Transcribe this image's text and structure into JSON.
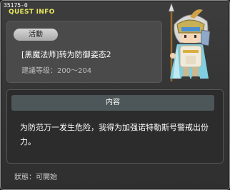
{
  "window": {
    "quest_id": "35175-0",
    "title": "QUEST INFO"
  },
  "quest": {
    "category_badge": "活動",
    "name": "[黑魔法师]转为防御姿态2",
    "level_label": "建議等级",
    "level_range": "200～204"
  },
  "content": {
    "header": "内容",
    "description": "为防范万一发生危险，我得为加强诺特勒斯号警戒出份力。"
  },
  "status": {
    "label": "狀態",
    "value": "可開始"
  },
  "npc": {
    "icon": "npc-knight-portrait"
  },
  "colors": {
    "title": "#e8e860",
    "window_bg": "#363636",
    "section_header_bg": "#4d5658",
    "badge_bg": "#c0c0c0"
  }
}
